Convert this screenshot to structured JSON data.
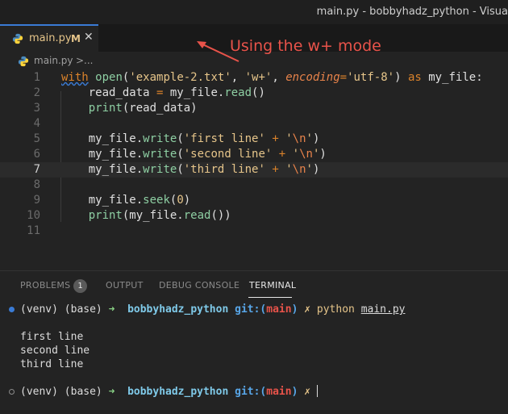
{
  "window": {
    "title": "main.py - bobbyhadz_python - Visua"
  },
  "tab": {
    "filename": "main.py",
    "modified_flag": "M",
    "close_glyph": "✕"
  },
  "breadcrumb": {
    "file": "main.py",
    "separator": ">",
    "more": "..."
  },
  "annotation": {
    "text": "Using the w+ mode",
    "color": "#e8534a"
  },
  "code": {
    "line_numbers": [
      "1",
      "2",
      "3",
      "4",
      "5",
      "6",
      "7",
      "8",
      "9",
      "10",
      "11"
    ],
    "current_line": 7,
    "lines": [
      [
        {
          "t": "with",
          "c": "kw",
          "sq": true
        },
        {
          "t": " ",
          "c": "var"
        },
        {
          "t": "open",
          "c": "fn"
        },
        {
          "t": "(",
          "c": "var"
        },
        {
          "t": "'example-2.txt'",
          "c": "str"
        },
        {
          "t": ", ",
          "c": "var"
        },
        {
          "t": "'w+'",
          "c": "str"
        },
        {
          "t": ", ",
          "c": "var"
        },
        {
          "t": "encoding",
          "c": "param"
        },
        {
          "t": "=",
          "c": "op"
        },
        {
          "t": "'utf-8'",
          "c": "str"
        },
        {
          "t": ") ",
          "c": "var"
        },
        {
          "t": "as",
          "c": "kw"
        },
        {
          "t": " my_file:",
          "c": "var"
        }
      ],
      [
        {
          "t": "    read_data ",
          "c": "var"
        },
        {
          "t": "=",
          "c": "op"
        },
        {
          "t": " my_file.",
          "c": "var"
        },
        {
          "t": "read",
          "c": "fn"
        },
        {
          "t": "()",
          "c": "var"
        }
      ],
      [
        {
          "t": "    ",
          "c": "var"
        },
        {
          "t": "print",
          "c": "fn"
        },
        {
          "t": "(read_data)",
          "c": "var"
        }
      ],
      [],
      [
        {
          "t": "    my_file.",
          "c": "var"
        },
        {
          "t": "write",
          "c": "fn"
        },
        {
          "t": "(",
          "c": "var"
        },
        {
          "t": "'first line'",
          "c": "str"
        },
        {
          "t": " ",
          "c": "var"
        },
        {
          "t": "+",
          "c": "op"
        },
        {
          "t": " ",
          "c": "var"
        },
        {
          "t": "'",
          "c": "str"
        },
        {
          "t": "\\n",
          "c": "esc"
        },
        {
          "t": "'",
          "c": "str"
        },
        {
          "t": ")",
          "c": "var"
        }
      ],
      [
        {
          "t": "    my_file.",
          "c": "var"
        },
        {
          "t": "write",
          "c": "fn"
        },
        {
          "t": "(",
          "c": "var"
        },
        {
          "t": "'second line'",
          "c": "str"
        },
        {
          "t": " ",
          "c": "var"
        },
        {
          "t": "+",
          "c": "op"
        },
        {
          "t": " ",
          "c": "var"
        },
        {
          "t": "'",
          "c": "str"
        },
        {
          "t": "\\n",
          "c": "esc"
        },
        {
          "t": "'",
          "c": "str"
        },
        {
          "t": ")",
          "c": "var"
        }
      ],
      [
        {
          "t": "    my_file.",
          "c": "var"
        },
        {
          "t": "write",
          "c": "fn"
        },
        {
          "t": "(",
          "c": "var"
        },
        {
          "t": "'third line'",
          "c": "str"
        },
        {
          "t": " ",
          "c": "var"
        },
        {
          "t": "+",
          "c": "op"
        },
        {
          "t": " ",
          "c": "var"
        },
        {
          "t": "'",
          "c": "str"
        },
        {
          "t": "\\n",
          "c": "esc"
        },
        {
          "t": "'",
          "c": "str"
        },
        {
          "t": ")",
          "c": "var"
        }
      ],
      [],
      [
        {
          "t": "    my_file.",
          "c": "var"
        },
        {
          "t": "seek",
          "c": "fn"
        },
        {
          "t": "(",
          "c": "var"
        },
        {
          "t": "0",
          "c": "num"
        },
        {
          "t": ")",
          "c": "var"
        }
      ],
      [
        {
          "t": "    ",
          "c": "var"
        },
        {
          "t": "print",
          "c": "fn"
        },
        {
          "t": "(my_file.",
          "c": "var"
        },
        {
          "t": "read",
          "c": "fn"
        },
        {
          "t": "())",
          "c": "var"
        }
      ],
      []
    ]
  },
  "panel": {
    "tabs": [
      "PROBLEMS",
      "OUTPUT",
      "DEBUG CONSOLE",
      "TERMINAL"
    ],
    "active_tab": "TERMINAL",
    "problems_count": "1"
  },
  "terminal": {
    "prompt_env": "(venv) (base)",
    "arrow": "➜",
    "dir": "bobbyhadz_python",
    "git_prefix": "git:(",
    "branch": "main",
    "git_suffix": ")",
    "dirty": "✗",
    "command_name": "python",
    "command_arg": "main.py",
    "output": [
      "first line",
      "second line",
      "third line"
    ],
    "dot_colors": {
      "done": "#3a7bd5",
      "pending": "#8a8a8a"
    }
  }
}
